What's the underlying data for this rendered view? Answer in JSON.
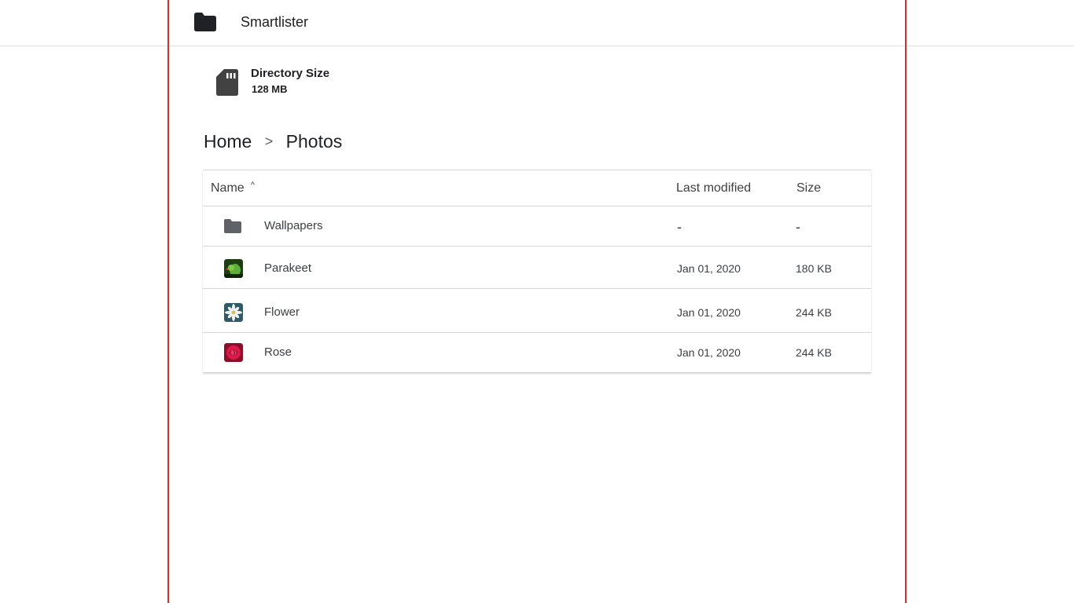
{
  "app": {
    "title": "Smartlister"
  },
  "directory": {
    "label": "Directory Size",
    "value": "128 MB"
  },
  "breadcrumb": {
    "items": [
      "Home",
      "Photos"
    ],
    "separator": ">"
  },
  "table": {
    "columns": {
      "name": "Name",
      "sort_indicator": "^",
      "modified": "Last modified",
      "size": "Size"
    },
    "rows": [
      {
        "name": "Wallpapers",
        "modified": "-",
        "size": "-",
        "icon": "folder-icon"
      },
      {
        "name": "Parakeet",
        "modified": "Jan 01, 2020",
        "size": "180 KB",
        "icon": "parakeet-thumbnail"
      },
      {
        "name": "Flower",
        "modified": "Jan 01, 2020",
        "size": "244 KB",
        "icon": "flower-thumbnail"
      },
      {
        "name": "Rose",
        "modified": "Jan 01, 2020",
        "size": "244 KB",
        "icon": "rose-thumbnail"
      }
    ]
  },
  "colors": {
    "guide": "#d32f2f",
    "icon": "#424242",
    "divider": "#d6d6d6"
  }
}
